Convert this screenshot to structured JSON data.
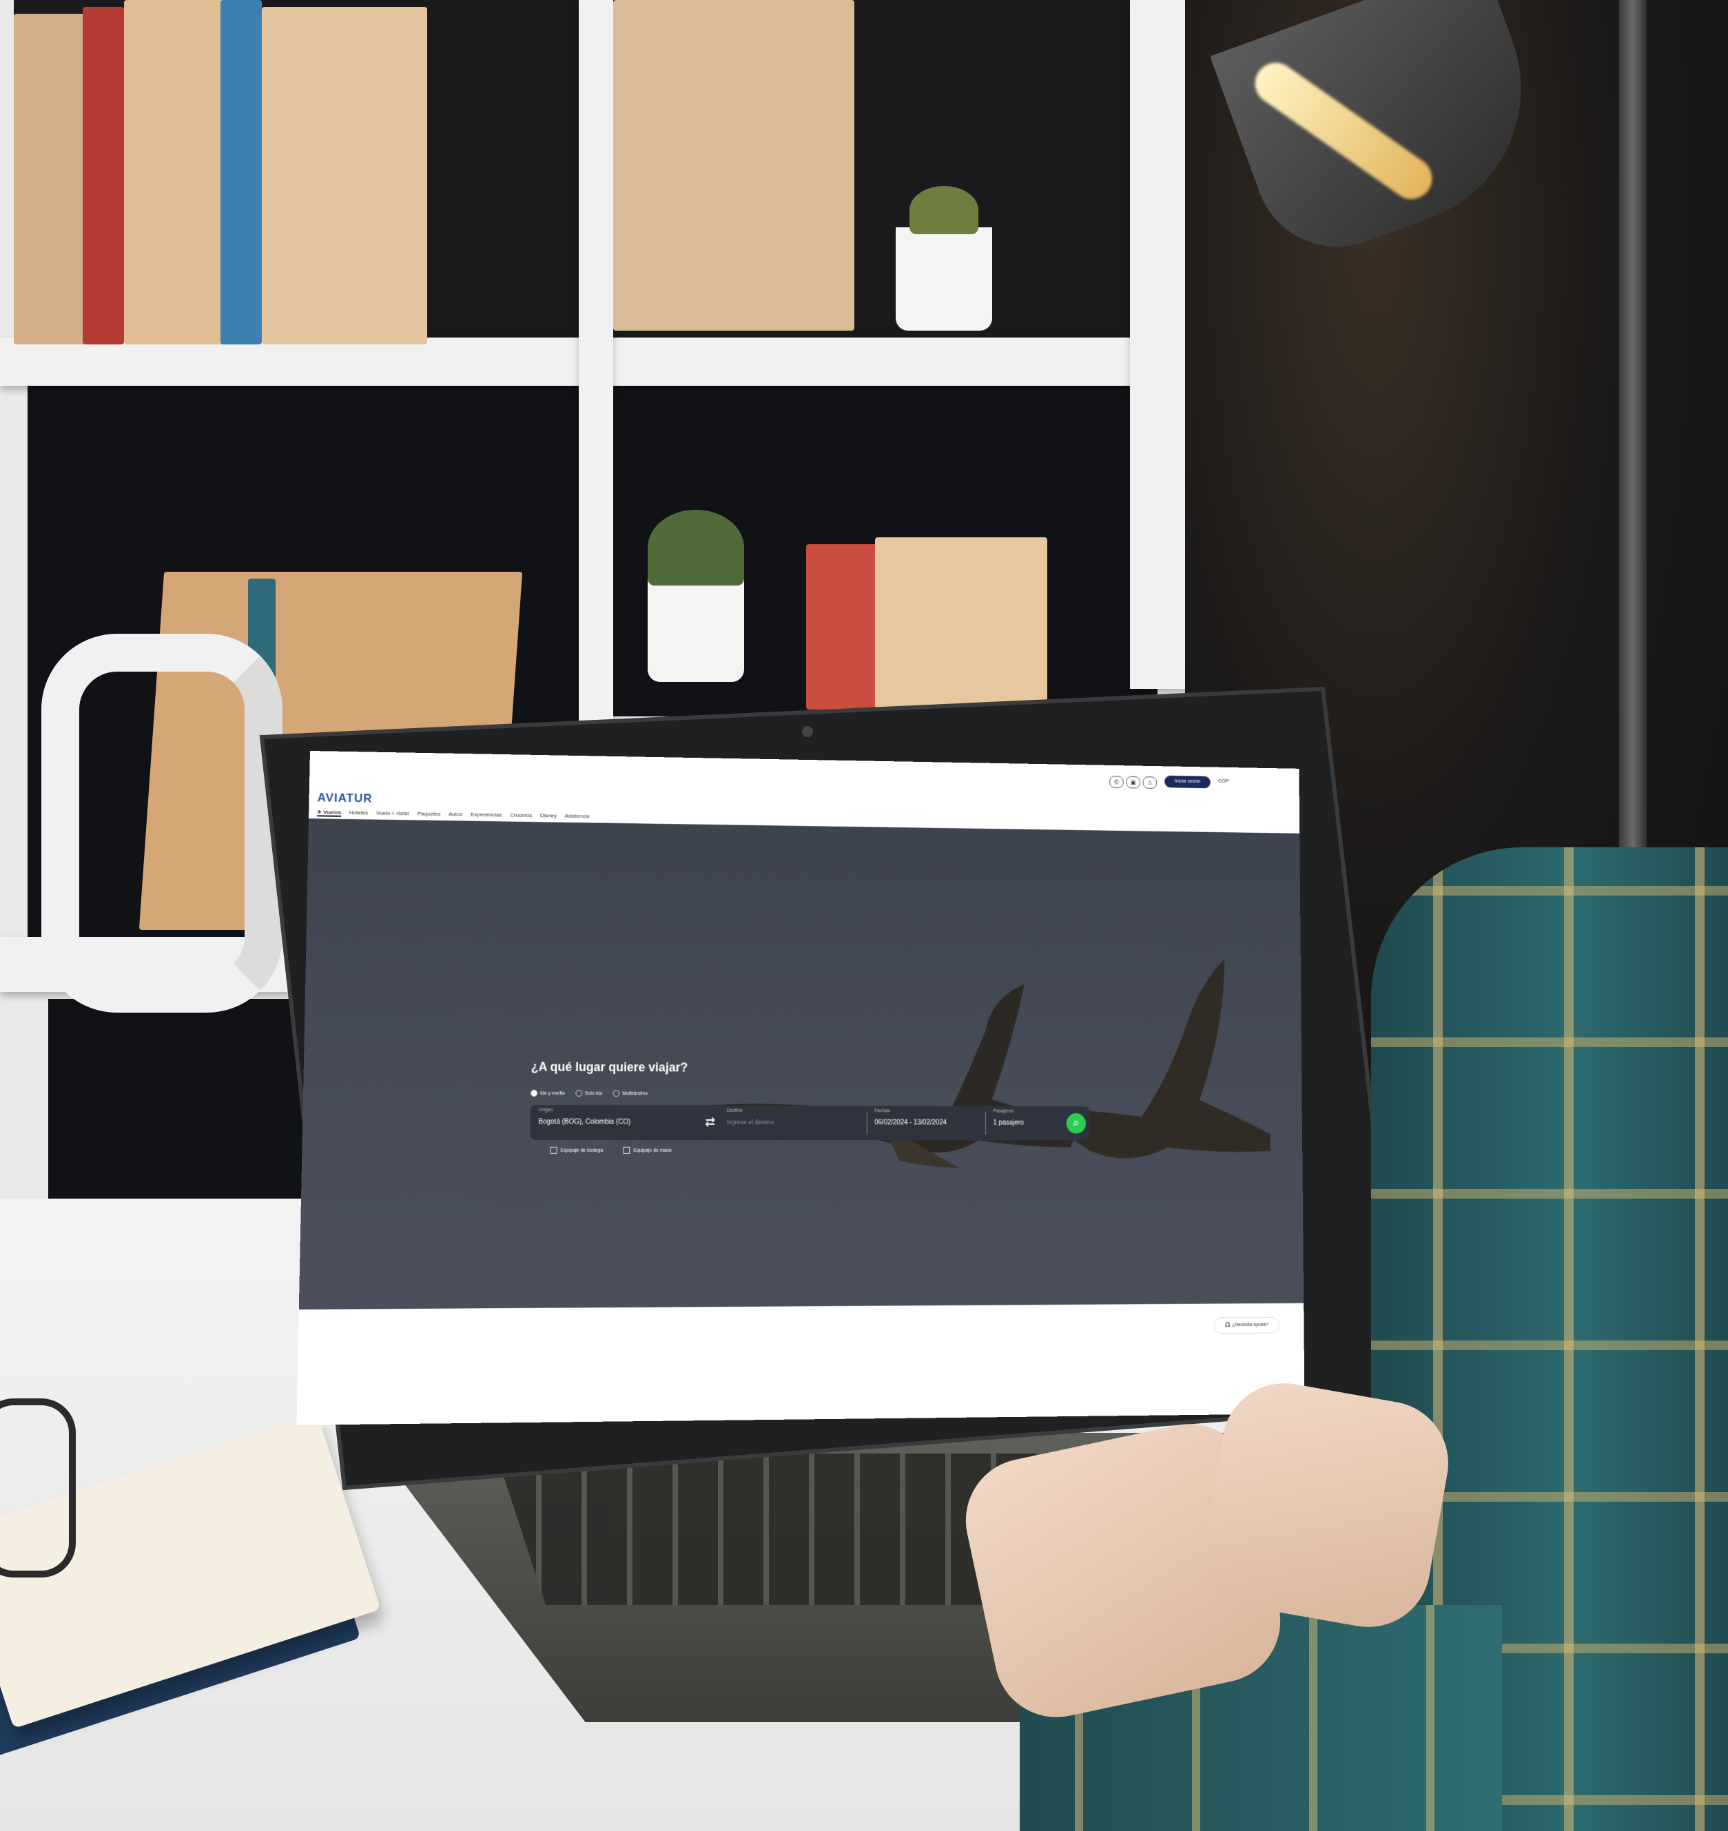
{
  "site": {
    "logo": "AVIATUR",
    "nav": [
      "✈ Vuelos",
      "Hoteles",
      "Vuelo + Hotel",
      "Paquetes",
      "Autos",
      "Experiencias",
      "Cruceros",
      "Disney",
      "Asistencia"
    ],
    "login_label": "Iniciar sesión",
    "currency": "COP"
  },
  "search": {
    "headline": "¿A qué lugar quiere viajar?",
    "trip_types": [
      "Ida y vuelta",
      "Solo ida",
      "Multidestino"
    ],
    "origin_label": "Origen",
    "origin_value": "Bogotá (BOG), Colombia (CO)",
    "destination_label": "Destino",
    "destination_placeholder": "Ingrese el destino",
    "dates_label": "Fechas",
    "date_from": "06/02/2024",
    "date_to": "13/02/2024",
    "passengers_label": "Pasajeros",
    "passengers_value": "1 pasajero",
    "option_checked_bag": "Equipaje de bodega",
    "option_carry_on": "Equipaje de mano"
  },
  "help_button": "¿Necesita ayuda?",
  "colors": {
    "brand_blue": "#2b4fa8",
    "hero_bg": "#444955",
    "search_green": "#2ecc55"
  }
}
